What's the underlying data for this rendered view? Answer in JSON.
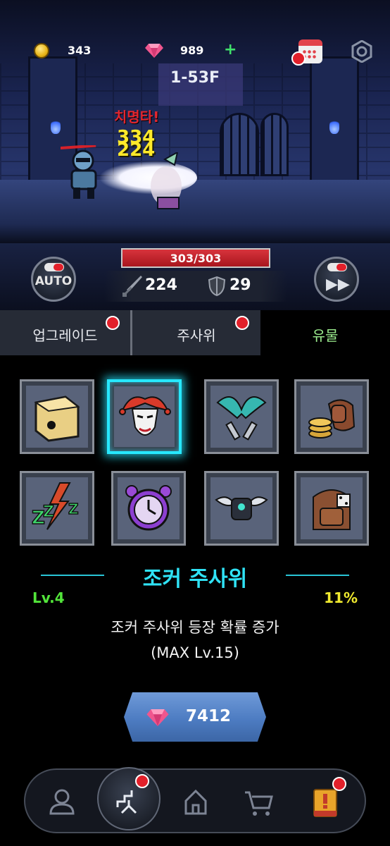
{
  "hud": {
    "coins": "343",
    "gems": "989",
    "icons": {
      "coin": "coin-icon",
      "gem": "gem-icon",
      "add": "plus-icon",
      "calendar": "calendar-icon",
      "settings": "gear-icon"
    }
  },
  "stage": {
    "label": "1-53F"
  },
  "battle": {
    "crit_text": "치명타!",
    "damage_numbers": [
      "334",
      "224"
    ],
    "enemy_hp_text": "303/303",
    "enemy_hp_fraction": 1.0,
    "auto_label": "AUTO",
    "attack": "224",
    "defense": "29"
  },
  "tabs": [
    {
      "label": "업그레이드",
      "active": false,
      "notification": true
    },
    {
      "label": "주사위",
      "active": false,
      "notification": true
    },
    {
      "label": "유물",
      "active": true,
      "notification": false
    }
  ],
  "relics": [
    {
      "icon": "golden-die-icon",
      "selected": false
    },
    {
      "icon": "jester-mask-icon",
      "selected": true
    },
    {
      "icon": "crossed-blades-icon",
      "selected": false
    },
    {
      "icon": "coin-fist-icon",
      "selected": false
    },
    {
      "icon": "lightning-zzz-icon",
      "selected": false
    },
    {
      "icon": "alarm-clock-icon",
      "selected": false
    },
    {
      "icon": "winged-cube-icon",
      "selected": false
    },
    {
      "icon": "dice-backpack-icon",
      "selected": false
    }
  ],
  "selected_relic": {
    "name": "조커 주사위",
    "level": "Lv.4",
    "percent": "11%",
    "description": "조커 주사위 등장 확률 증가",
    "max_level": "(MAX Lv.15)",
    "cost": "7412"
  },
  "colors": {
    "accent_cyan": "#2fe2f5",
    "level_green": "#52e43a",
    "percent_yellow": "#f0ea2f",
    "relic_tab_green": "#9dee8f",
    "notification_red": "#e2202a",
    "button_blue": "#4d7cc2"
  },
  "nav": [
    {
      "icon": "profile-icon",
      "notification": false,
      "active": false
    },
    {
      "icon": "stairs-icon",
      "notification": true,
      "active": true
    },
    {
      "icon": "home-icon",
      "notification": false,
      "active": false
    },
    {
      "icon": "cart-icon",
      "notification": false,
      "active": false
    },
    {
      "icon": "quest-book-icon",
      "notification": true,
      "active": false
    }
  ]
}
